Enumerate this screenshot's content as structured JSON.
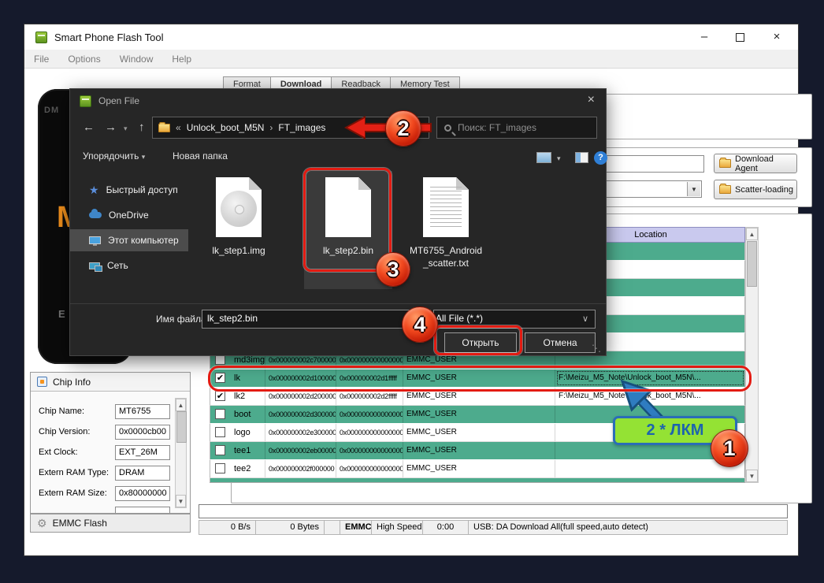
{
  "window": {
    "title": "Smart Phone Flash Tool",
    "menu": [
      "File",
      "Options",
      "Window",
      "Help"
    ],
    "tabs": [
      "Format",
      "Download",
      "Readback",
      "Memory Test"
    ],
    "active_tab": "Download",
    "controls": {
      "minimize": "–",
      "close": "×"
    }
  },
  "main": {
    "download_agent_button": "Download Agent",
    "scatter_loading_button": "Scatter-loading",
    "location_header": "Location",
    "rows": [
      {
        "name": "md3img",
        "checked": false,
        "begin": "0x000000002c700000",
        "end": "0x0000000000000000",
        "region": "EMMC_USER",
        "location": "",
        "green": true
      },
      {
        "name": "lk",
        "checked": true,
        "begin": "0x000000002d100000",
        "end": "0x000000002d1fffff",
        "region": "EMMC_USER",
        "location": "F:\\Meizu_M5_Note\\Unlock_boot_M5N\\...",
        "green": true,
        "selected": true
      },
      {
        "name": "lk2",
        "checked": true,
        "begin": "0x000000002d200000",
        "end": "0x000000002d2fffff",
        "region": "EMMC_USER",
        "location": "F:\\Meizu_M5_Note\\Unlock_boot_M5N\\...",
        "green": false
      },
      {
        "name": "boot",
        "checked": false,
        "begin": "0x000000002d300000",
        "end": "0x0000000000000000",
        "region": "EMMC_USER",
        "location": "",
        "green": true
      },
      {
        "name": "logo",
        "checked": false,
        "begin": "0x000000002e300000",
        "end": "0x0000000000000000",
        "region": "EMMC_USER",
        "location": "",
        "green": false
      },
      {
        "name": "tee1",
        "checked": false,
        "begin": "0x000000002eb00000",
        "end": "0x0000000000000000",
        "region": "EMMC_USER",
        "location": "",
        "green": true
      },
      {
        "name": "tee2",
        "checked": false,
        "begin": "0x000000002f000000",
        "end": "0x0000000000000000",
        "region": "EMMC_USER",
        "location": "",
        "green": false
      }
    ],
    "status": [
      "0 B/s",
      "0 Bytes",
      "",
      "EMMC",
      "High Speed",
      "0:00",
      "USB: DA Download All(full speed,auto detect)"
    ]
  },
  "chip_info": {
    "header": "Chip Info",
    "fields": [
      {
        "label": "Chip Name:",
        "value": "MT6755"
      },
      {
        "label": "Chip Version:",
        "value": "0x0000cb00"
      },
      {
        "label": "Ext Clock:",
        "value": "EXT_26M"
      },
      {
        "label": "Extern RAM Type:",
        "value": "DRAM"
      },
      {
        "label": "Extern RAM Size:",
        "value": "0x80000000"
      }
    ],
    "emmc_flash_label": "EMMC Flash"
  },
  "phone": {
    "top_text": "DM",
    "logo_letter": "M",
    "bottom_text": "E"
  },
  "dialog": {
    "title": "Open File",
    "close": "×",
    "nav": {
      "back": "←",
      "forward": "→",
      "caret": "▾",
      "up": "↑"
    },
    "breadcrumb": {
      "chevrons": "«",
      "folder1": "Unlock_boot_M5N",
      "sep": "›",
      "folder2": "FT_images"
    },
    "search_placeholder": "Поиск: FT_images",
    "toolbar": {
      "organize": "Упорядочить",
      "organize_caret": "▾",
      "new_folder": "Новая папка",
      "help": "?"
    },
    "sidebar": [
      {
        "label": "Быстрый доступ",
        "icon": "star"
      },
      {
        "label": "OneDrive",
        "icon": "cloud"
      },
      {
        "label": "Этот компьютер",
        "icon": "monitor",
        "selected": true
      },
      {
        "label": "Сеть",
        "icon": "network"
      }
    ],
    "files": [
      {
        "name": "lk_step1.img",
        "type": "img"
      },
      {
        "name": "lk_step2.bin",
        "type": "bin",
        "selected": true
      },
      {
        "name": "MT6755_Android",
        "name2": "_scatter.txt",
        "type": "txt"
      }
    ],
    "filename_label": "Имя файла:",
    "filename_value": "lk_step2.bin",
    "filetype_value": "All File (*.*)",
    "open_button": "Открыть",
    "cancel_button": "Отмена"
  },
  "annotations": {
    "step_1": "1",
    "step_2": "2",
    "step_3": "3",
    "step_4": "4",
    "double_click_label": "2 * ЛКМ"
  },
  "colors": {
    "green_row": "#4dab8d",
    "header_lavender": "#c9c9ee",
    "annotation_red": "#e32015",
    "annotation_green": "#94e234",
    "annotation_blue": "#2a6db8"
  }
}
